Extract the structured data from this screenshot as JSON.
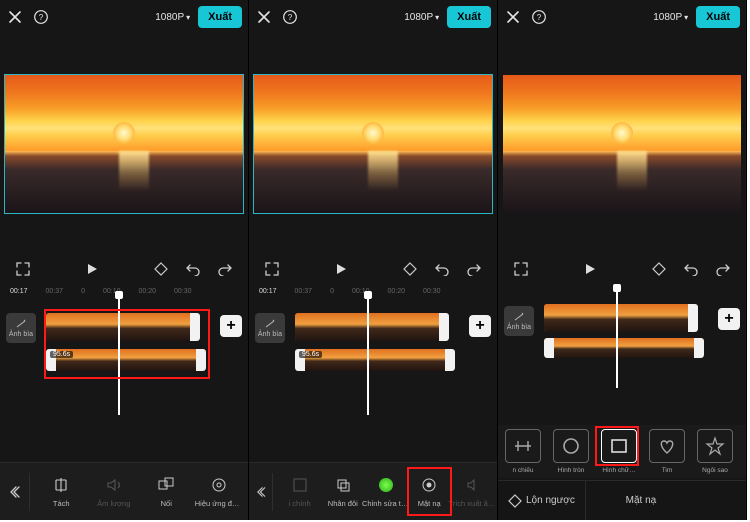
{
  "topbar": {
    "resolution_label": "1080P",
    "export_label": "Xuất"
  },
  "timecodes": {
    "current": "00:17",
    "total": "00:37",
    "ticks": [
      "0",
      "00:10",
      "00:20",
      "00:30"
    ]
  },
  "cover_label": "Ảnh bìa",
  "speed_label": "95.6s",
  "add_label": "+",
  "phone1_tools": [
    {
      "icon": "split",
      "label": "Tách"
    },
    {
      "icon": "volume",
      "label": "Âm lượng",
      "dim": true
    },
    {
      "icon": "overlay",
      "label": "Nối"
    },
    {
      "icon": "fx",
      "label": "Hiệu ứng động"
    }
  ],
  "phone2_tools": [
    {
      "icon": "adjust",
      "label": "i chính",
      "dim": true
    },
    {
      "icon": "duplicate",
      "label": "Nhân đôi"
    },
    {
      "icon": "hypic",
      "label": "Chỉnh sửa trên Hypic"
    },
    {
      "icon": "mask",
      "label": "Mặt nạ"
    },
    {
      "icon": "extract",
      "label": "Trích xuất âm thanh",
      "dim": true
    }
  ],
  "shapes": [
    {
      "key": "mirror",
      "label": "n chiếu"
    },
    {
      "key": "circle",
      "label": "Hình tròn"
    },
    {
      "key": "rect",
      "label": "Hình chữ…",
      "selected": true
    },
    {
      "key": "heart",
      "label": "Tim"
    },
    {
      "key": "star",
      "label": "Ngôi sao"
    }
  ],
  "bottom3": {
    "invert_label": "Lộn ngược",
    "title": "Mặt nạ"
  }
}
